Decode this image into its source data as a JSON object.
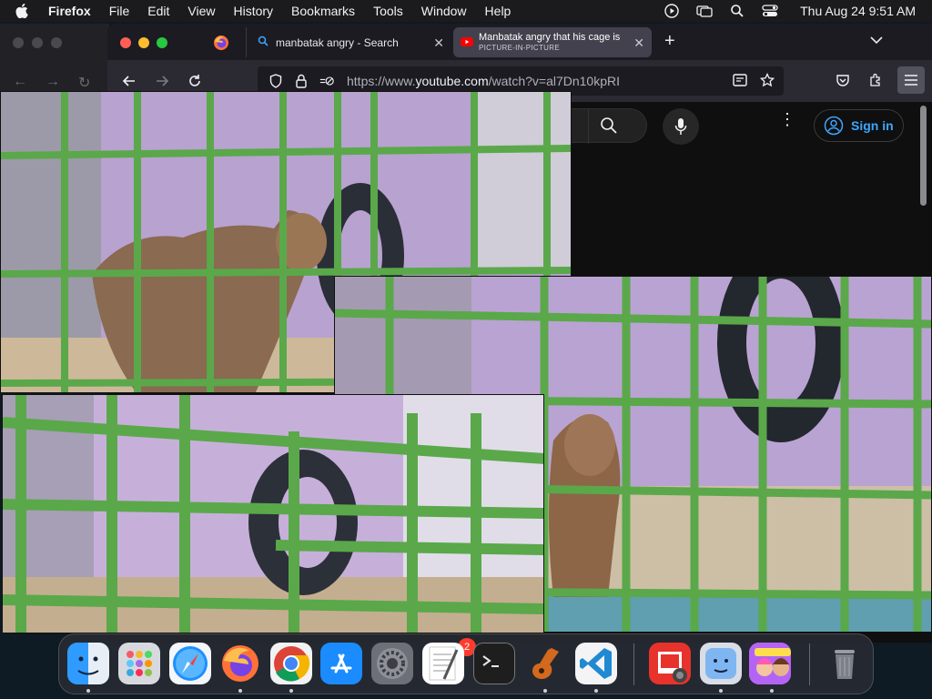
{
  "menubar": {
    "app_name": "Firefox",
    "items": [
      "File",
      "Edit",
      "View",
      "History",
      "Bookmarks",
      "Tools",
      "Window",
      "Help"
    ],
    "clock": "Thu Aug 24  9:51 AM"
  },
  "browser": {
    "tabs": [
      {
        "label": "manbatak angry - Search",
        "icon": "search-icon"
      },
      {
        "label": "Manbatak angry that his cage is",
        "sublabel": "PICTURE-IN-PICTURE",
        "icon": "youtube-icon"
      }
    ],
    "url_prefix": "https://www.",
    "url_domain": "youtube.com",
    "url_path": "/watch?v=al7Dn10kpRI"
  },
  "youtube": {
    "sign_in_label": "Sign in"
  },
  "pip_windows": [
    {
      "subject": "monkey standing behind green cage bars"
    },
    {
      "subject": "monkey sitting behind green cage bars with tire swing"
    },
    {
      "subject": "blurred green cage bars with tire swing"
    }
  ],
  "dock": {
    "apps": [
      "Finder",
      "Launchpad",
      "Safari",
      "Firefox",
      "Chrome",
      "App Store",
      "System Settings",
      "TextEdit",
      "Terminal",
      "GarageBand",
      "Visual Studio Code",
      "Photo Booth",
      "Finder",
      "Game",
      "Trash"
    ],
    "settings_badge": "2"
  },
  "colors": {
    "accent_blue": "#3ea6ff",
    "cage_green": "#5aa84a",
    "wall_lilac": "#b9a3d2"
  }
}
